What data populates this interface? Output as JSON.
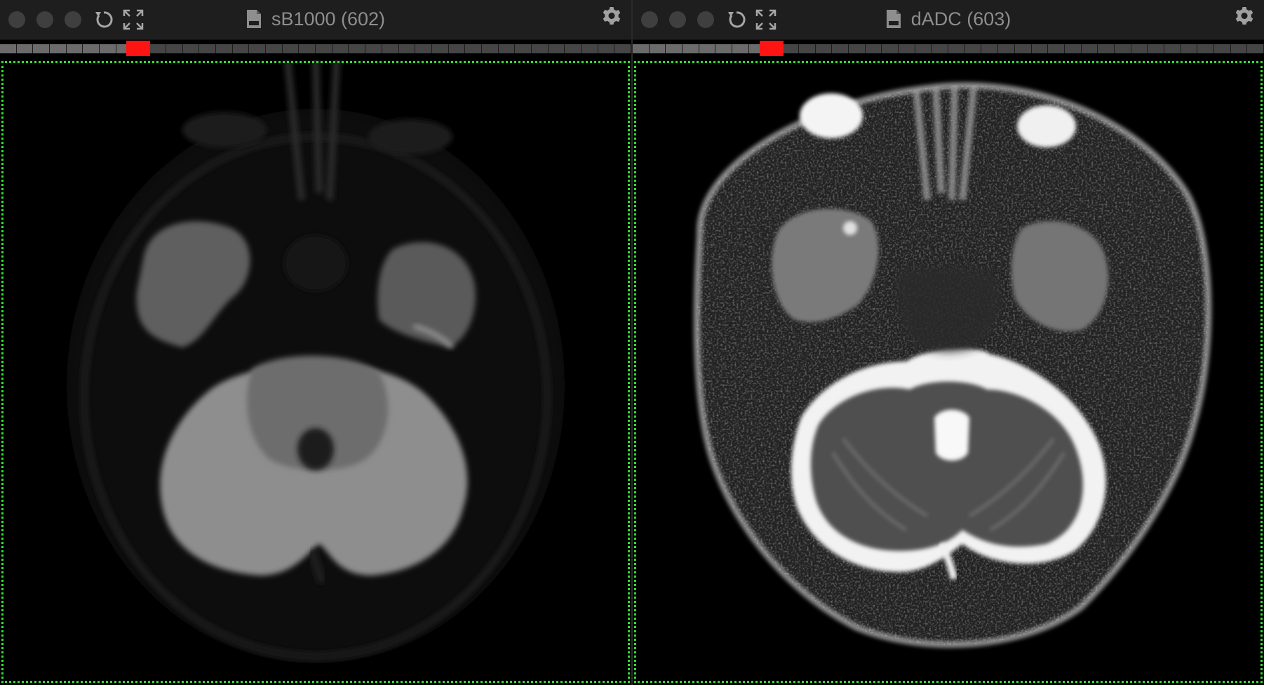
{
  "viewers": [
    {
      "title": "sB1000 (602)",
      "file_icon": "dicom-file-icon",
      "settings_icon": "gear-icon",
      "reset_icon": "reset-rotate-icon",
      "fullscreen_icon": "expand-arrows-icon",
      "selected_frame_color": "#2ee22e"
    },
    {
      "title": "dADC (603)",
      "file_icon": "dicom-file-icon",
      "settings_icon": "gear-icon",
      "reset_icon": "reset-rotate-icon",
      "fullscreen_icon": "expand-arrows-icon",
      "selected_frame_color": "#2ee22e"
    }
  ],
  "slice_marker_color": "#ff1414"
}
